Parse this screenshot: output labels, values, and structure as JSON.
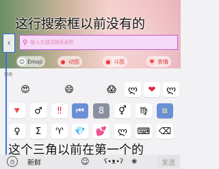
{
  "annotations": {
    "top": "这行搜索框以前没有的",
    "bottom": "这个三角以前在第一个的"
  },
  "search": {
    "back_icon": "chevron-left-icon",
    "placeholder": "输入关键词搜索表情"
  },
  "categories": [
    {
      "label": "Emoji",
      "icon": "smiley-icon"
    },
    {
      "label": "动图",
      "icon": "gif-icon"
    },
    {
      "label": "斗图",
      "icon": "sticker-icon"
    },
    {
      "label": "表情",
      "icon": "heart-icon"
    }
  ],
  "section_label": "常用",
  "grid_rows": [
    [
      "😍",
      "",
      "😄",
      "",
      "😱",
      "ლ",
      "❤",
      "ლ"
    ],
    [
      "🔻",
      "♂",
      "‼",
      "⏮",
      "8",
      "⚥",
      "♍",
      "🔢"
    ],
    [
      "♀",
      "Σ",
      "♈",
      "💎",
      "💕",
      "ლ",
      "⌨",
      "⌫"
    ]
  ],
  "bottom_bar": {
    "clock_icon": "clock-icon",
    "new_label": "新鲜",
    "emoji_icon": "smiley-icon",
    "send_label": "发送"
  }
}
